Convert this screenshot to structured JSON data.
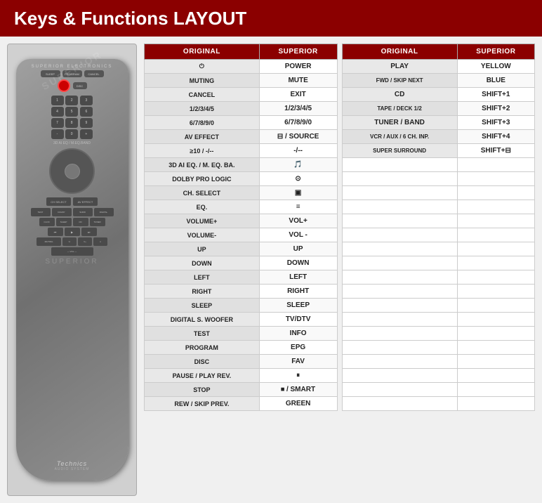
{
  "header": {
    "title": "Keys & Functions LAYOUT"
  },
  "table_left": {
    "col1_header": "ORIGINAL",
    "col2_header": "SUPERIOR",
    "rows": [
      {
        "original": "⏻",
        "superior": "POWER"
      },
      {
        "original": "MUTING",
        "superior": "MUTE"
      },
      {
        "original": "CANCEL",
        "superior": "EXIT"
      },
      {
        "original": "1/2/3/4/5",
        "superior": "1/2/3/4/5"
      },
      {
        "original": "6/7/8/9/0",
        "superior": "6/7/8/9/0"
      },
      {
        "original": "AV EFFECT",
        "superior": "⊟ / SOURCE"
      },
      {
        "original": "≥10 / -/--",
        "superior": "-/--"
      },
      {
        "original": "3D AI EQ. / M. EQ. BA.",
        "superior": "🎵"
      },
      {
        "original": "DOLBY PRO LOGIC",
        "superior": "⊙"
      },
      {
        "original": "CH. SELECT",
        "superior": "▣"
      },
      {
        "original": "EQ.",
        "superior": "≡"
      },
      {
        "original": "VOLUME+",
        "superior": "VOL+"
      },
      {
        "original": "VOLUME-",
        "superior": "VOL -"
      },
      {
        "original": "UP",
        "superior": "UP"
      },
      {
        "original": "DOWN",
        "superior": "DOWN"
      },
      {
        "original": "LEFT",
        "superior": "LEFT"
      },
      {
        "original": "RIGHT",
        "superior": "RIGHT"
      },
      {
        "original": "SLEEP",
        "superior": "SLEEP"
      },
      {
        "original": "DIGITAL S. WOOFER",
        "superior": "TV/DTV"
      },
      {
        "original": "TEST",
        "superior": "INFO"
      },
      {
        "original": "PROGRAM",
        "superior": "EPG"
      },
      {
        "original": "DISC",
        "superior": "FAV"
      },
      {
        "original": "PAUSE / PLAY REV.",
        "superior": "⏸"
      },
      {
        "original": "STOP",
        "superior": "⏹ / SMART"
      },
      {
        "original": "REW / SKIP PREV.",
        "superior": "GREEN"
      }
    ]
  },
  "table_right": {
    "col1_header": "ORIGINAL",
    "col2_header": "SUPERIOR",
    "rows": [
      {
        "original": "PLAY",
        "superior": "YELLOW"
      },
      {
        "original": "FWD / SKIP NEXT",
        "superior": "BLUE"
      },
      {
        "original": "CD",
        "superior": "SHIFT+1"
      },
      {
        "original": "TAPE / DECK 1/2",
        "superior": "SHIFT+2"
      },
      {
        "original": "TUNER / BAND",
        "superior": "SHIFT+3"
      },
      {
        "original": "VCR / AUX / 6 CH. INP.",
        "superior": "SHIFT+4"
      },
      {
        "original": "SUPER SURROUND",
        "superior": "SHIFT+⊟"
      },
      {
        "original": "",
        "superior": ""
      },
      {
        "original": "",
        "superior": ""
      },
      {
        "original": "",
        "superior": ""
      },
      {
        "original": "",
        "superior": ""
      },
      {
        "original": "",
        "superior": ""
      },
      {
        "original": "",
        "superior": ""
      },
      {
        "original": "",
        "superior": ""
      },
      {
        "original": "",
        "superior": ""
      },
      {
        "original": "",
        "superior": ""
      },
      {
        "original": "",
        "superior": ""
      },
      {
        "original": "",
        "superior": ""
      },
      {
        "original": "",
        "superior": ""
      },
      {
        "original": "",
        "superior": ""
      },
      {
        "original": "",
        "superior": ""
      },
      {
        "original": "",
        "superior": ""
      },
      {
        "original": "",
        "superior": ""
      },
      {
        "original": "",
        "superior": ""
      },
      {
        "original": "",
        "superior": ""
      }
    ]
  },
  "remote": {
    "brand": "Technics",
    "sub": "AUDIO SYSTEM",
    "watermark": "SUPERIOR"
  },
  "colors": {
    "header_bg": "#8b0000",
    "table_header_bg": "#8b0000"
  }
}
